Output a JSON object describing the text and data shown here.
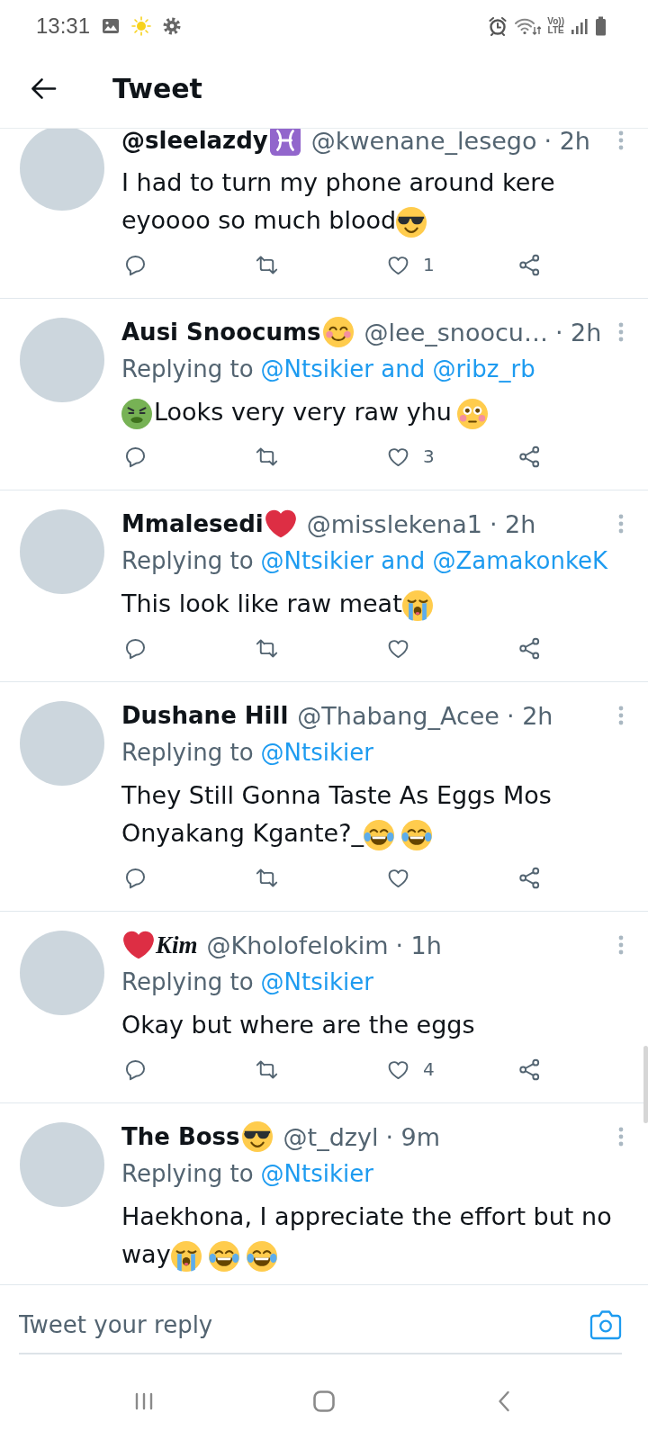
{
  "status_bar": {
    "time": "13:31",
    "network_label": [
      "Vo))",
      "LTE"
    ]
  },
  "header": {
    "title": "Tweet"
  },
  "tweets": [
    {
      "author": [
        {
          "kind": "text",
          "text": "@sleelazdy"
        },
        {
          "kind": "pisces"
        }
      ],
      "handle": "@kwenane_lesego",
      "time": "· 2h",
      "body": [
        {
          "kind": "text",
          "text": "I had to turn my phone around kere eyoooo so much blood"
        },
        {
          "kind": "sunglasses"
        }
      ],
      "likes": "1"
    },
    {
      "author": [
        {
          "kind": "text",
          "text": "Ausi Snoocums"
        },
        {
          "kind": "blush"
        }
      ],
      "handle": "@lee_snoocu…",
      "time": "· 2h",
      "replying_to": {
        "label": "Replying to",
        "mentions": "@Ntsikier and @ribz_rb"
      },
      "body": [
        {
          "kind": "nauseated"
        },
        {
          "kind": "text",
          "text": "Looks very very raw yhu"
        },
        {
          "kind": "flushed"
        }
      ],
      "likes": "3"
    },
    {
      "author": [
        {
          "kind": "text",
          "text": "Mmalesedi"
        },
        {
          "kind": "heart"
        }
      ],
      "handle": "@misslekena1",
      "time": "· 2h",
      "replying_to": {
        "label": "Replying to",
        "mentions": "@Ntsikier and @ZamakonkeK"
      },
      "body": [
        {
          "kind": "text",
          "text": "This look like raw meat"
        },
        {
          "kind": "sob"
        }
      ]
    },
    {
      "author": [
        {
          "kind": "text",
          "text": "Dushane Hill"
        }
      ],
      "handle": "@Thabang_Acee",
      "time": "· 2h",
      "replying_to": {
        "label": "Replying to",
        "mentions": "@Ntsikier"
      },
      "body": [
        {
          "kind": "text",
          "text": "They Still Gonna Taste As Eggs Mos Onyakang Kgante?_"
        },
        {
          "kind": "joy"
        },
        {
          "kind": "joy"
        }
      ]
    },
    {
      "author": [
        {
          "kind": "heart"
        },
        {
          "kind": "text",
          "text": "Kim",
          "script": true
        }
      ],
      "handle": "@Kholofelokim",
      "time": "· 1h",
      "replying_to": {
        "label": "Replying to",
        "mentions": "@Ntsikier"
      },
      "body": [
        {
          "kind": "text",
          "text": "Okay but where are the eggs"
        }
      ],
      "likes": "4"
    },
    {
      "author": [
        {
          "kind": "text",
          "text": "The Boss"
        },
        {
          "kind": "sunglasses"
        }
      ],
      "handle": "@t_dzyl",
      "time": "· 9m",
      "replying_to": {
        "label": "Replying to",
        "mentions": "@Ntsikier"
      },
      "body": [
        {
          "kind": "text",
          "text": "Haekhona, I appreciate the effort but no way"
        },
        {
          "kind": "sob"
        },
        {
          "kind": "joy"
        },
        {
          "kind": "joy"
        }
      ]
    }
  ],
  "reply_box": {
    "placeholder": "Tweet your reply"
  }
}
